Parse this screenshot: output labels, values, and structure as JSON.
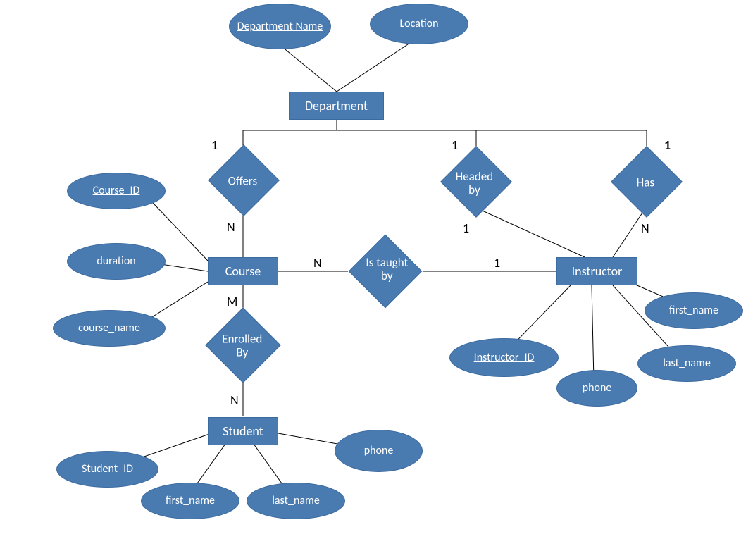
{
  "entities": {
    "department": "Department",
    "course": "Course",
    "instructor": "Instructor",
    "student": "Student"
  },
  "attributes": {
    "department_name": "Department Name",
    "location": "Location",
    "course_id": "Course_ID",
    "duration": "duration",
    "course_name": "course_name",
    "instructor_id": "Instructor_ID",
    "phone_instr": "phone",
    "first_name_instr": "first_name",
    "last_name_instr": "last_name",
    "student_id": "Student_ID",
    "first_name_stu": "first_name",
    "last_name_stu": "last_name",
    "phone_stu": "phone"
  },
  "relationships": {
    "offers": "Offers",
    "headed_by": "Headed by",
    "has": "Has",
    "is_taught_by": "Is taught by",
    "enrolled_by": "Enrolled By"
  },
  "cardinalities": {
    "offers_dept": "1",
    "offers_course": "N",
    "headed_dept": "1",
    "headed_instr": "1",
    "has_dept": "1",
    "has_instr": "N",
    "taught_course": "N",
    "taught_instr": "1",
    "enrolled_course": "M",
    "enrolled_student": "N"
  }
}
